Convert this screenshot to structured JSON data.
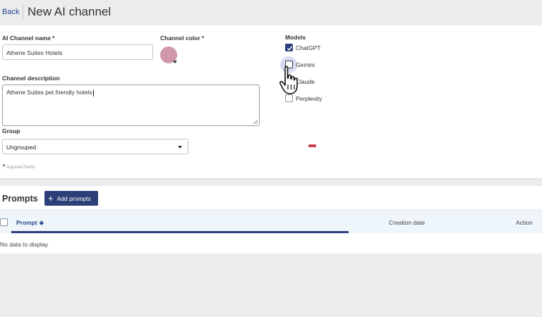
{
  "header": {
    "back_label": "Back",
    "title": "New AI channel"
  },
  "form": {
    "name_label": "AI Channel name",
    "name_value": "Athene Suites Hotels",
    "color_label": "Channel color",
    "color_value": "#d197ab",
    "required_mark": "*",
    "description_label": "Channel description",
    "description_value": "Athene Suites pet friendly hotels",
    "group_label": "Group",
    "group_value": "Ungrouped",
    "required_note_mark": "*",
    "required_note": "required fields"
  },
  "models": {
    "label": "Models",
    "items": [
      {
        "name": "ChatGPT",
        "checked": true
      },
      {
        "name": "Gemini",
        "checked": false
      },
      {
        "name": "Claude",
        "checked": false
      },
      {
        "name": "Perplexity",
        "checked": false
      }
    ]
  },
  "prompts": {
    "title": "Prompts",
    "add_button": "Add prompts",
    "columns": {
      "prompt": "Prompt",
      "creation_date": "Creation date",
      "action": "Action"
    },
    "empty_text": "No data to display"
  },
  "colors": {
    "primary": "#2d3f78",
    "link": "#2e4a8c",
    "danger": "#c94152"
  }
}
